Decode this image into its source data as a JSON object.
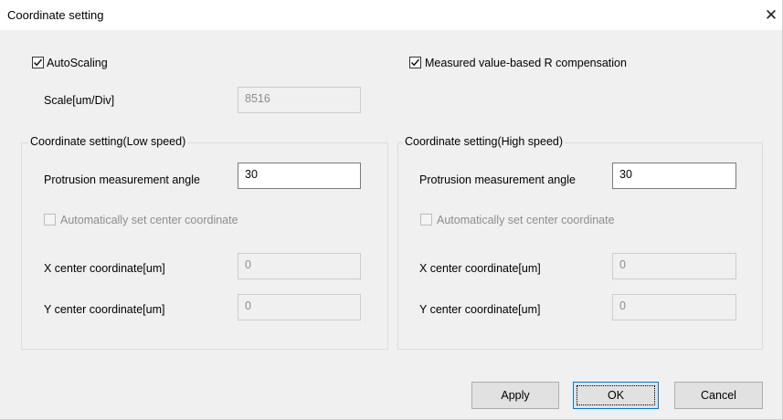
{
  "window": {
    "title": "Coordinate setting",
    "close_icon": "✕"
  },
  "autoscaling": {
    "label": "AutoScaling",
    "checked": true
  },
  "r_compensation": {
    "label": "Measured value-based R compensation",
    "checked": true
  },
  "scale": {
    "label": "Scale[um/Div]",
    "value": "8516"
  },
  "low_speed": {
    "title": "Coordinate setting(Low speed)",
    "protrusion_label": "Protrusion measurement angle",
    "protrusion_value": "30",
    "auto_center_label": "Automatically set center coordinate",
    "auto_center_checked": false,
    "x_label": "X center coordinate[um]",
    "x_value": "0",
    "y_label": "Y center coordinate[um]",
    "y_value": "0"
  },
  "high_speed": {
    "title": "Coordinate setting(High speed)",
    "protrusion_label": "Protrusion measurement angle",
    "protrusion_value": "30",
    "auto_center_label": "Automatically set center coordinate",
    "auto_center_checked": false,
    "x_label": "X center coordinate[um]",
    "x_value": "0",
    "y_label": "Y center coordinate[um]",
    "y_value": "0"
  },
  "buttons": {
    "apply": "Apply",
    "ok": "OK",
    "cancel": "Cancel"
  }
}
